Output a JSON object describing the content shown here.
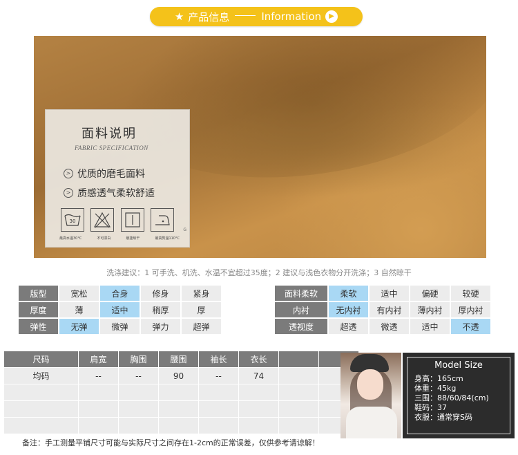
{
  "banner": {
    "cn": "产品信息",
    "en": "Information"
  },
  "fabric_card": {
    "title": "面料说明",
    "subtitle": "FABRIC SPECIFICATION",
    "features": [
      "优质的磨毛面料",
      "质感透气柔软舒适"
    ],
    "care_icons": [
      {
        "icon": "wash-30-icon",
        "text": "30",
        "label": "最高水温30°C"
      },
      {
        "icon": "no-bleach-icon",
        "text": "",
        "label": "不可漂白"
      },
      {
        "icon": "hang-dry-icon",
        "text": "",
        "label": "悬挂晾干"
      },
      {
        "icon": "iron-110-icon",
        "text": "",
        "label": "最高熨温110°C"
      }
    ],
    "mark": "G"
  },
  "wash_advice": "洗涤建议：1 可手洗、机洗、水温不宜超过35度；2 建议与浅色衣物分开洗涤；3 自然晾干",
  "attributes_left": [
    {
      "label": "版型",
      "options": [
        "宽松",
        "合身",
        "修身",
        "紧身"
      ],
      "selected": 1
    },
    {
      "label": "厚度",
      "options": [
        "薄",
        "适中",
        "稍厚",
        "厚"
      ],
      "selected": 1
    },
    {
      "label": "弹性",
      "options": [
        "无弹",
        "微弹",
        "弹力",
        "超弹"
      ],
      "selected": 0
    }
  ],
  "attributes_right": [
    {
      "label": "面料柔软",
      "options": [
        "柔软",
        "适中",
        "偏硬",
        "较硬"
      ],
      "selected": 0
    },
    {
      "label": "内衬",
      "options": [
        "无内衬",
        "有内衬",
        "薄内衬",
        "厚内衬"
      ],
      "selected": 0
    },
    {
      "label": "透视度",
      "options": [
        "超透",
        "微透",
        "适中",
        "不透"
      ],
      "selected": 3
    }
  ],
  "size_table": {
    "headers": [
      "尺码",
      "肩宽",
      "胸围",
      "腰围",
      "袖长",
      "衣长",
      "",
      ""
    ],
    "rows": [
      [
        "均码",
        "--",
        "--",
        "90",
        "--",
        "74",
        "",
        ""
      ],
      [
        "",
        "",
        "",
        "",
        "",
        "",
        "",
        ""
      ],
      [
        "",
        "",
        "",
        "",
        "",
        "",
        "",
        ""
      ],
      [
        "",
        "",
        "",
        "",
        "",
        "",
        "",
        ""
      ]
    ]
  },
  "note": "备注：手工测量平铺尺寸可能与实际尺寸之间存在1-2cm的正常误差，仅供参考请谅解！",
  "model": {
    "title": "Model Size",
    "rows": [
      "身高：165cm",
      "体重：45kg",
      "三围：88/60/84(cm)",
      "鞋码：37",
      "衣服：通常穿S码"
    ]
  }
}
